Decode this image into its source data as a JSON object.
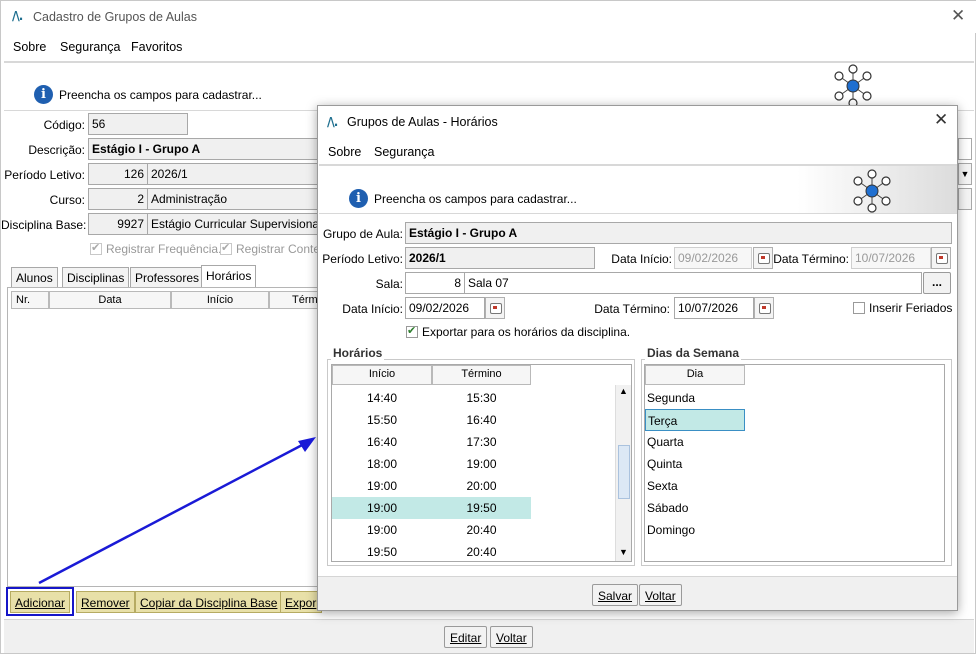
{
  "main_window": {
    "title": "Cadastro de Grupos de Aulas",
    "menu": [
      "Sobre",
      "Segurança",
      "Favoritos"
    ],
    "info_message": "Preencha os campos para cadastrar...",
    "fields": {
      "codigo_label": "Código:",
      "codigo_value": "56",
      "descricao_label": "Descrição:",
      "descricao_value": "Estágio I - Grupo A",
      "periodo_label": "Período Letivo:",
      "periodo_code": "126",
      "periodo_value": "2026/1",
      "curso_label": "Curso:",
      "curso_code": "2",
      "curso_value": "Administração",
      "disciplina_label": "Disciplina Base:",
      "disciplina_code": "9927",
      "disciplina_value": "Estágio Curricular Supervisionad"
    },
    "checks": {
      "registrar_frequencia": "Registrar Frequência.",
      "registrar_conteudo": "Registrar Conte"
    },
    "tabs": [
      "Alunos",
      "Disciplinas",
      "Professores",
      "Horários"
    ],
    "active_tab": "Horários",
    "table_headers": [
      "Nr.",
      "Data",
      "Início",
      "Térmi"
    ],
    "bottom_buttons": {
      "adicionar": "Adicionar",
      "remover": "Remover",
      "copiar": "Copiar da Disciplina Base",
      "exportar": "Expor"
    },
    "footer_buttons": {
      "editar": "Editar",
      "voltar": "Voltar"
    }
  },
  "dialog": {
    "title": "Grupos de Aulas - Horários",
    "menu": [
      "Sobre",
      "Segurança"
    ],
    "info_message": "Preencha os campos para cadastrar...",
    "grupo_label": "Grupo de Aula:",
    "grupo_value": "Estágio I - Grupo A",
    "periodo_label": "Período Letivo:",
    "periodo_value": "2026/1",
    "data_inicio_label": "Data Início:",
    "data_inicio_disabled": "09/02/2026",
    "data_termino_label": "Data Término:",
    "data_termino_disabled": "10/07/2026",
    "sala_label": "Sala:",
    "sala_code": "8",
    "sala_value": "Sala 07",
    "sala_lookup": "...",
    "data_inicio2_label": "Data Início:",
    "data_inicio2_value": "09/02/2026",
    "data_termino2_label": "Data Término:",
    "data_termino2_value": "10/07/2026",
    "inserir_feriados": "Inserir Feriados",
    "exportar_check": "Exportar para os horários da disciplina.",
    "horarios_title": "Horários",
    "horarios_headers": [
      "Início",
      "Término"
    ],
    "horarios_rows": [
      {
        "inicio": "14:40",
        "termino": "15:30"
      },
      {
        "inicio": "15:50",
        "termino": "16:40"
      },
      {
        "inicio": "16:40",
        "termino": "17:30"
      },
      {
        "inicio": "18:00",
        "termino": "19:00"
      },
      {
        "inicio": "19:00",
        "termino": "20:00"
      },
      {
        "inicio": "19:00",
        "termino": "19:50"
      },
      {
        "inicio": "19:00",
        "termino": "20:40"
      },
      {
        "inicio": "19:50",
        "termino": "20:40"
      }
    ],
    "horarios_selected_index": 5,
    "dias_title": "Dias da Semana",
    "dias_header": "Dia",
    "dias": [
      "Segunda",
      "Terça",
      "Quarta",
      "Quinta",
      "Sexta",
      "Sábado",
      "Domingo"
    ],
    "dias_selected_index": 1,
    "buttons": {
      "salvar": "Salvar",
      "voltar": "Voltar"
    }
  },
  "annotation": {
    "arrow_color": "#1a1ad6"
  }
}
